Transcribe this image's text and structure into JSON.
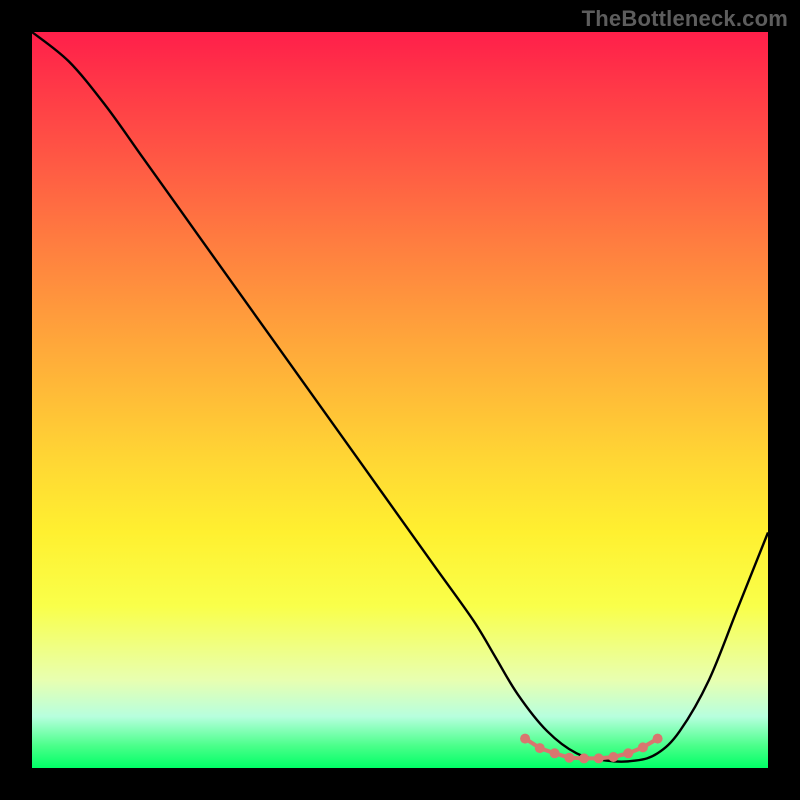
{
  "watermark": "TheBottleneck.com",
  "chart_data": {
    "type": "line",
    "title": "",
    "xlabel": "",
    "ylabel": "",
    "xlim": [
      0,
      100
    ],
    "ylim": [
      0,
      100
    ],
    "series": [
      {
        "name": "bottleneck-curve",
        "x": [
          0,
          5,
          10,
          15,
          20,
          25,
          30,
          35,
          40,
          45,
          50,
          55,
          60,
          63,
          66,
          70,
          74,
          78,
          82,
          85,
          88,
          92,
          96,
          100
        ],
        "y": [
          100,
          96,
          90,
          83,
          76,
          69,
          62,
          55,
          48,
          41,
          34,
          27,
          20,
          15,
          10,
          5,
          2,
          1,
          1,
          2,
          5,
          12,
          22,
          32
        ]
      }
    ],
    "markers": {
      "name": "optimal-range",
      "color": "#d9766f",
      "x": [
        67,
        69,
        71,
        73,
        75,
        77,
        79,
        81,
        83,
        85
      ],
      "y": [
        4,
        2.7,
        2,
        1.4,
        1.3,
        1.3,
        1.5,
        2,
        2.8,
        4
      ]
    },
    "gradient_stops": [
      {
        "pos": 0,
        "color": "#ff1f4a"
      },
      {
        "pos": 50,
        "color": "#ffd634"
      },
      {
        "pos": 80,
        "color": "#f9ff4a"
      },
      {
        "pos": 100,
        "color": "#00ff66"
      }
    ]
  }
}
